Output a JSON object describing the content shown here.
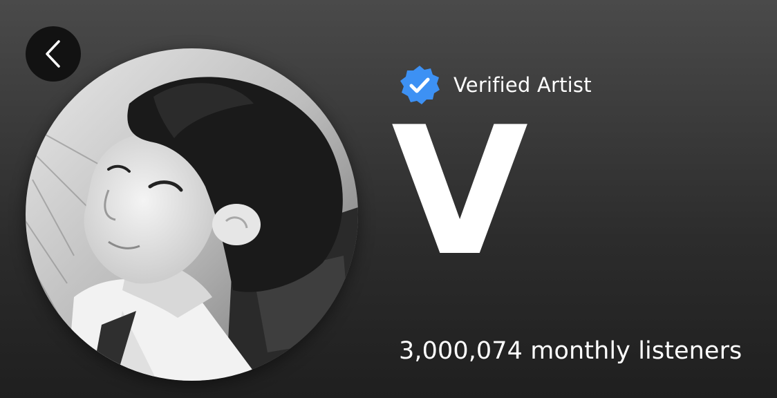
{
  "navigation": {
    "back_icon": "chevron-left-icon"
  },
  "artist": {
    "verified_icon": "verified-badge-icon",
    "verified_label": "Verified Artist",
    "name": "V",
    "monthly_listeners": "3,000,074 monthly listeners",
    "avatar_icon": "artist-photo"
  },
  "colors": {
    "badge_blue": "#3d91f4",
    "back_button_bg": "#121212",
    "text": "#ffffff"
  }
}
